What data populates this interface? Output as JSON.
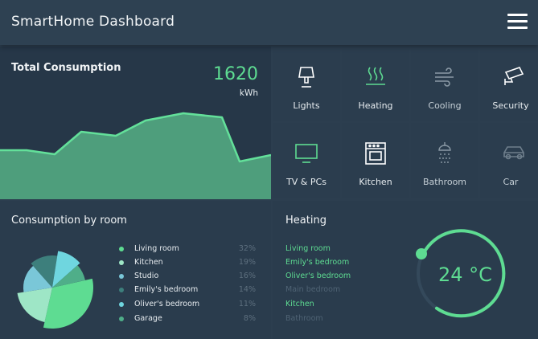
{
  "header": {
    "title": "SmartHome Dashboard",
    "menu_icon": "hamburger-menu-icon"
  },
  "total_consumption": {
    "title": "Total Consumption",
    "value": "1620",
    "unit": "kWh",
    "area_color": "#4e9e7c",
    "line_color": "#63e09a"
  },
  "devices": [
    {
      "label": "Lights",
      "icon": "lamp-icon",
      "color": "#ffffff"
    },
    {
      "label": "Heating",
      "icon": "heat-waves-icon",
      "color": "#5edc92"
    },
    {
      "label": "Cooling",
      "icon": "wind-icon",
      "color": "#8b9aa6"
    },
    {
      "label": "Security",
      "icon": "security-camera-icon",
      "color": "#ffffff"
    },
    {
      "label": "TV & PCs",
      "icon": "monitor-icon",
      "color": "#5edc92"
    },
    {
      "label": "Kitchen",
      "icon": "oven-icon",
      "color": "#ffffff"
    },
    {
      "label": "Bathroom",
      "icon": "shower-icon",
      "color": "#8b9aa6"
    },
    {
      "label": "Car",
      "icon": "car-icon",
      "color": "#6f7f8c"
    }
  ],
  "consumption_by_room": {
    "title": "Consumption by room",
    "rooms": [
      {
        "name": "Living room",
        "percent": "32%",
        "value": 32,
        "color": "#5edc92"
      },
      {
        "name": "Kitchen",
        "percent": "19%",
        "value": 19,
        "color": "#9ee6c6"
      },
      {
        "name": "Studio",
        "percent": "16%",
        "value": 16,
        "color": "#7ac7d8"
      },
      {
        "name": "Emily's bedroom",
        "percent": "14%",
        "value": 14,
        "color": "#3d7f7c"
      },
      {
        "name": "Oliver's bedroom",
        "percent": "11%",
        "value": 11,
        "color": "#6fd6df"
      },
      {
        "name": "Garage",
        "percent": "8%",
        "value": 8,
        "color": "#4fae89"
      }
    ]
  },
  "heating": {
    "title": "Heating",
    "rooms": [
      {
        "name": "Living room",
        "active": true
      },
      {
        "name": "Emily's bedroom",
        "active": true
      },
      {
        "name": "Oliver's bedroom",
        "active": true
      },
      {
        "name": "Main bedroom",
        "active": false
      },
      {
        "name": "Kitchen",
        "active": true
      },
      {
        "name": "Bathroom",
        "active": false
      }
    ],
    "temperature": "24 °C",
    "accent": "#5edc92"
  }
}
